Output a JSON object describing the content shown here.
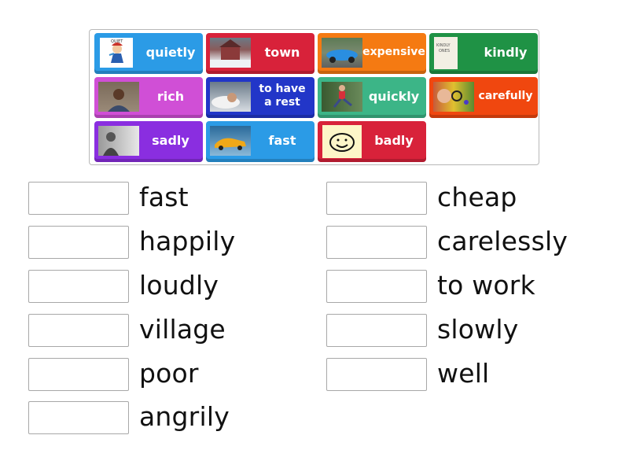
{
  "tiles": [
    {
      "label": "quietly",
      "image": "cartoon-girl-quiet",
      "color": "#2b9be6"
    },
    {
      "label": "town",
      "image": "snowy-town-house",
      "color": "#d8223a"
    },
    {
      "label": "expensive",
      "image": "blue-sports-car",
      "color": "#f57a12"
    },
    {
      "label": "kindly",
      "image": "kindly-ones-book",
      "color": "#1f9245"
    },
    {
      "label": "rich",
      "image": "man-portrait",
      "color": "#d04fd6"
    },
    {
      "label": "to have a rest",
      "image": "man-sleeping",
      "color": "#2236c8"
    },
    {
      "label": "quickly",
      "image": "boy-running",
      "color": "#3cb587"
    },
    {
      "label": "carefully",
      "image": "boy-magnifier",
      "color": "#f0470f"
    },
    {
      "label": "sadly",
      "image": "sad-man",
      "color": "#8a2ee0"
    },
    {
      "label": "fast",
      "image": "yellow-car",
      "color": "#2b9be6"
    },
    {
      "label": "badly",
      "image": "smiley-drawing",
      "color": "#d8223a"
    }
  ],
  "targets_left": [
    "fast",
    "happily",
    "loudly",
    "village",
    "poor",
    "angrily"
  ],
  "targets_right": [
    "cheap",
    "carelessly",
    "to work",
    "slowly",
    "well"
  ]
}
